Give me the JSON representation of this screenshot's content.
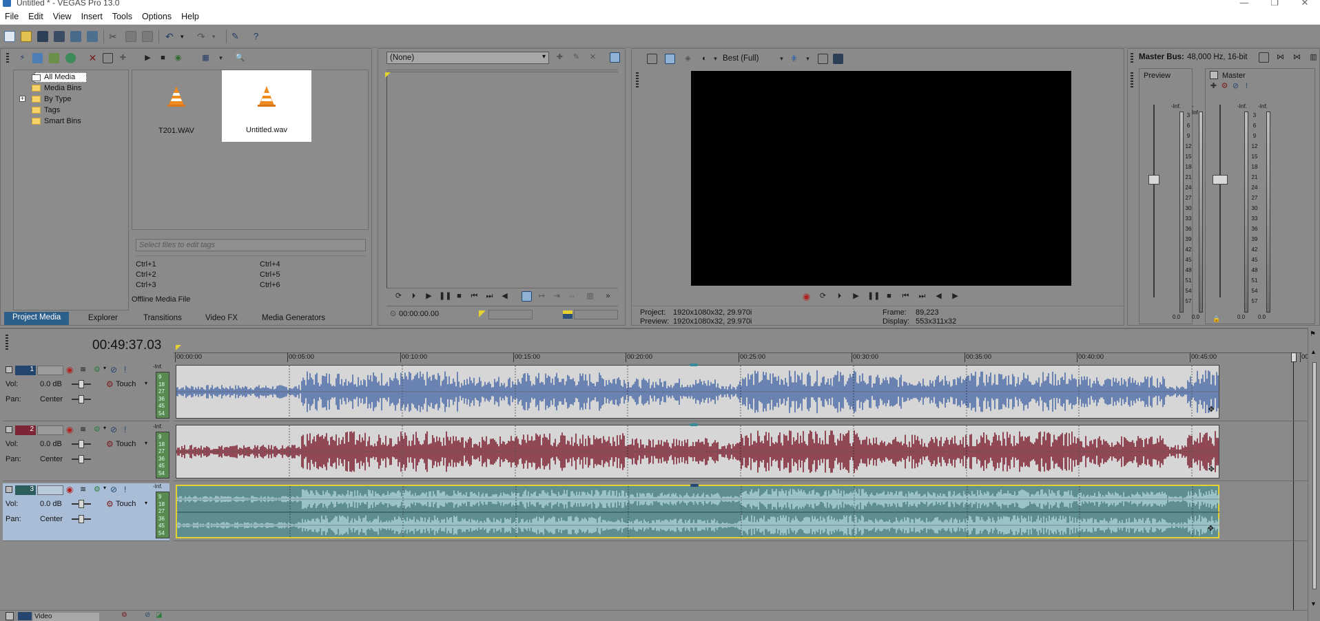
{
  "window": {
    "title": "Untitled * - VEGAS Pro 13.0"
  },
  "menu": [
    "File",
    "Edit",
    "View",
    "Insert",
    "Tools",
    "Options",
    "Help"
  ],
  "media": {
    "tree": [
      {
        "label": "All Media"
      },
      {
        "label": "Media Bins"
      },
      {
        "label": "By Type"
      },
      {
        "label": "Tags"
      },
      {
        "label": "Smart Bins"
      }
    ],
    "files": [
      {
        "name": "T201.WAV",
        "selected": false
      },
      {
        "name": "Untitled.wav",
        "selected": true
      }
    ],
    "tag_placeholder": "Select files to edit tags",
    "shortcuts": [
      "Ctrl+1",
      "Ctrl+4",
      "Ctrl+2",
      "Ctrl+5",
      "Ctrl+3",
      "Ctrl+6"
    ],
    "offline_label": "Offline Media File",
    "tabs": [
      "Project Media",
      "Explorer",
      "Transitions",
      "Video FX",
      "Media Generators"
    ],
    "active_tab": "Project Media"
  },
  "trimmer": {
    "dropdown": "(None)",
    "timecode": "00:00:00.00"
  },
  "preview": {
    "quality": "Best (Full)",
    "project_label": "Project:",
    "project_value": "1920x1080x32, 29.970i",
    "preview_label": "Preview:",
    "preview_value": "1920x1080x32, 29.970i",
    "frame_label": "Frame:",
    "frame_value": "89,223",
    "display_label": "Display:",
    "display_value": "553x311x32"
  },
  "master": {
    "title": "Master Bus:",
    "format": "48,000 Hz, 16-bit",
    "preview_label": "Preview",
    "master_label": "Master",
    "peak_top": "-Inf.",
    "scale": [
      "3",
      "6",
      "9",
      "12",
      "15",
      "18",
      "21",
      "24",
      "27",
      "30",
      "33",
      "36",
      "39",
      "42",
      "45",
      "48",
      "51",
      "54",
      "57"
    ],
    "bottom_value": "0.0"
  },
  "timeline": {
    "current_time": "00:49:37.03",
    "ruler": [
      "00:00:00",
      "00:05:00",
      "00:10:00",
      "00:15:00",
      "00:20:00",
      "00:25:00",
      "00:30:00",
      "00:35:00",
      "00:40:00",
      "00:45:00",
      "00:"
    ],
    "tracks": [
      {
        "number": "1",
        "vol_label": "Vol:",
        "vol": "0.0 dB",
        "pan_label": "Pan:",
        "pan": "Center",
        "mode": "Touch",
        "meter_top": "-Inf.",
        "meter_scale": [
          "9",
          "18",
          "27",
          "36",
          "45",
          "54"
        ],
        "color": "#4f6ea8",
        "bg": "#d6d6d6",
        "selected": false
      },
      {
        "number": "2",
        "vol_label": "Vol:",
        "vol": "0.0 dB",
        "pan_label": "Pan:",
        "pan": "Center",
        "mode": "Touch",
        "meter_top": "-Inf.",
        "meter_scale": [
          "9",
          "18",
          "27",
          "36",
          "45",
          "54"
        ],
        "color": "#7e2535",
        "bg": "#d6d6d6",
        "selected": false
      },
      {
        "number": "3",
        "vol_label": "Vol:",
        "vol": "0.0 dB",
        "pan_label": "Pan:",
        "pan": "Center",
        "mode": "Touch",
        "meter_top": "-Inf.",
        "meter_scale": [
          "9",
          "18",
          "27",
          "36",
          "45",
          "54"
        ],
        "color": "#a9d0d5",
        "bg": "#5e8e90",
        "selected": true
      }
    ],
    "video_track_label": "Video"
  },
  "colors": {
    "bg": "#8a8a8a",
    "accent_tab": "#2c5f8a",
    "track1": "#4f6ea8",
    "track2": "#7e2535",
    "track3_wave": "#a9d0d5",
    "track3_bg": "#5e8e90",
    "vlc_orange": "#f08a1e"
  }
}
